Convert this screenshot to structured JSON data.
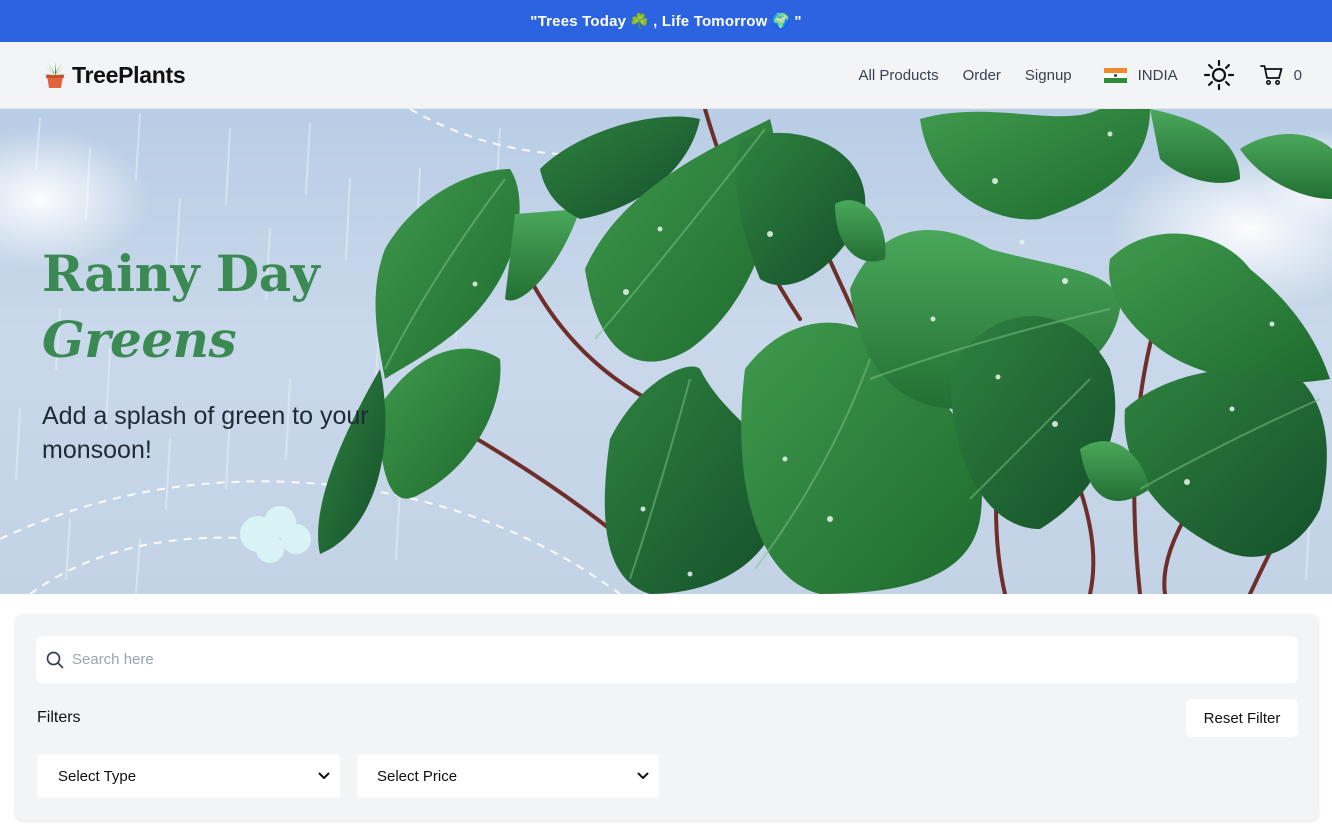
{
  "announcement": {
    "text_before": "\"Trees Today",
    "emoji_1": "☘️",
    "text_middle": ", Life Tomorrow",
    "emoji_2": "🌍",
    "text_after": "\""
  },
  "header": {
    "brand": "TreePlants",
    "nav": {
      "products": "All Products",
      "order": "Order",
      "signup": "Signup"
    },
    "country": "INDIA",
    "cart_count": "0"
  },
  "hero": {
    "title_line1": "Rainy Day",
    "title_line2": "Greens",
    "subtitle": "Add a splash of green to your monsoon!"
  },
  "filters": {
    "search_placeholder": "Search here",
    "label": "Filters",
    "reset_label": "Reset Filter",
    "type_select": "Select Type",
    "price_select": "Select Price"
  },
  "colors": {
    "announcement_bg": "#2b63e0",
    "hero_title": "#3b8a54",
    "header_bg": "#f3f4f6"
  },
  "icons": [
    "plant-logo-icon",
    "india-flag-icon",
    "sun-icon",
    "cart-icon",
    "search-icon",
    "chevron-down-icon"
  ]
}
